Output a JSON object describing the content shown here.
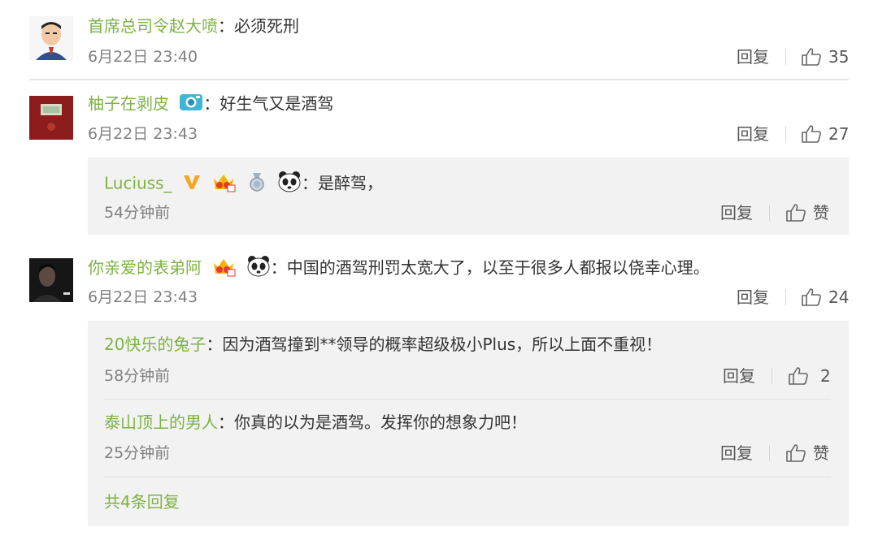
{
  "comments": [
    {
      "user": "首席总司令赵大喷",
      "colon": "：",
      "text": "必须死刑",
      "time": "6月22日 23:40",
      "reply_label": "回复",
      "likes": "35"
    },
    {
      "user": "柚子在剥皮",
      "colon": "：",
      "text": "好生气又是酒驾",
      "time": "6月22日 23:43",
      "reply_label": "回复",
      "likes": "27",
      "replies": [
        {
          "user": "Luciuss_",
          "colon": "：",
          "text": "是醉驾，",
          "time": "54分钟前",
          "reply_label": "回复",
          "likes": "赞"
        }
      ]
    },
    {
      "user": "你亲爱的表弟阿",
      "colon": "：",
      "text": "中国的酒驾刑罚太宽大了，以至于很多人都报以侥幸心理。",
      "time": "6月22日 23:43",
      "reply_label": "回复",
      "likes": "24",
      "replies": [
        {
          "user": "20快乐的兔子",
          "colon": "：",
          "text": "因为酒驾撞到**领导的概率超级极小Plus，所以上面不重视！",
          "time": "58分钟前",
          "reply_label": "回复",
          "likes": "2"
        },
        {
          "user": "泰山顶上的男人",
          "colon": "：",
          "text": "你真的以为是酒驾。发挥你的想象力吧！",
          "time": "25分钟前",
          "reply_label": "回复",
          "likes": "赞"
        }
      ],
      "more_replies": "共4条回复"
    }
  ],
  "colors": {
    "username": "#7cb342",
    "meta": "#808080",
    "panel": "#f2f2f2"
  },
  "icons": [
    "thumbs-up-icon",
    "camera-badge-icon",
    "v-verified-icon",
    "crown-badge-icon",
    "medal-badge-icon",
    "panda-emoji-icon"
  ]
}
